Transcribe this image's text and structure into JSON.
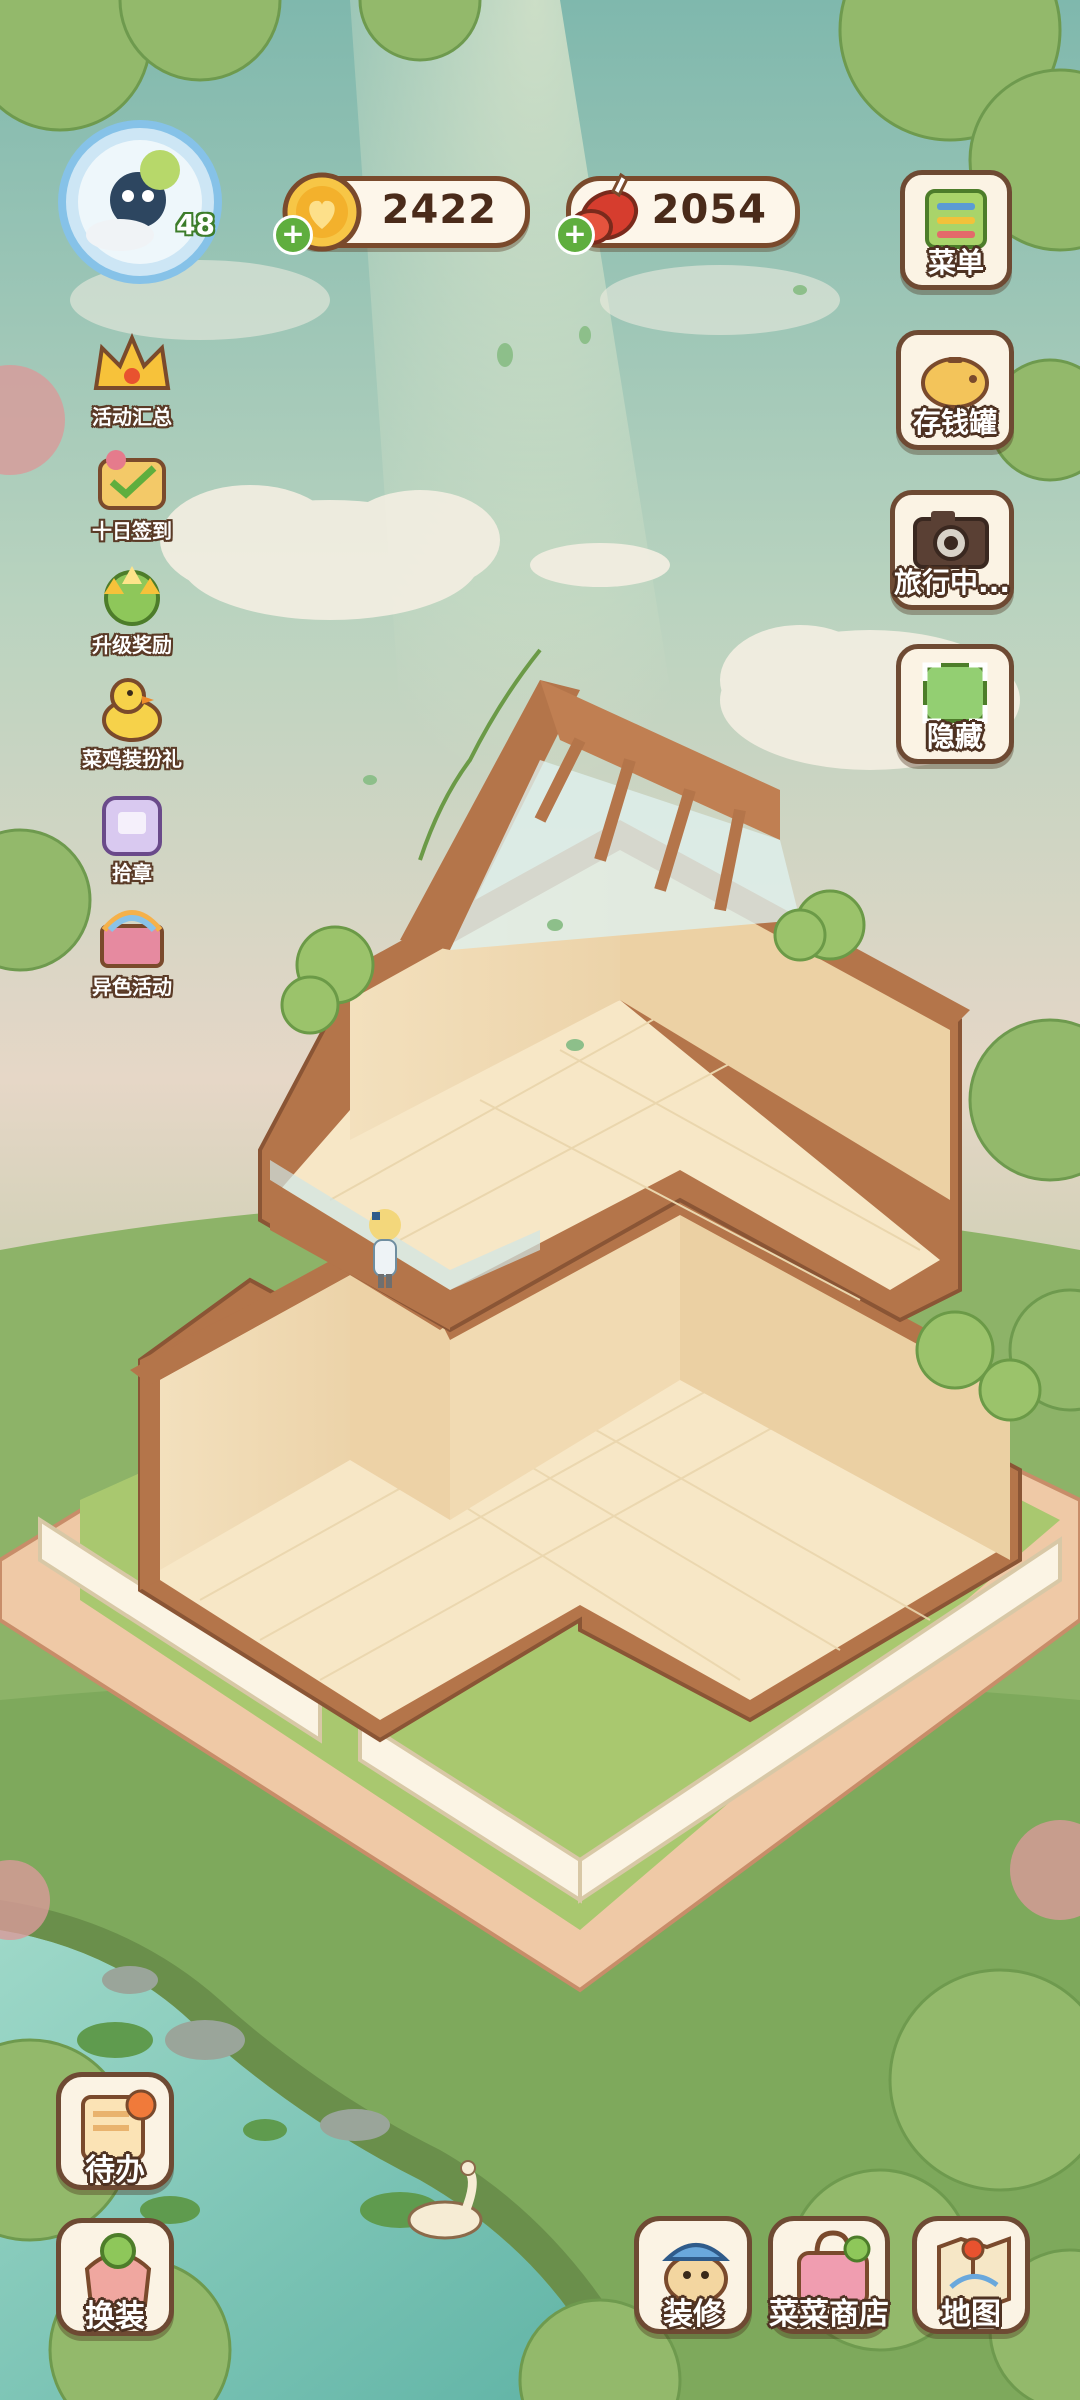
{
  "currency": {
    "coins": "2422",
    "vegetables": "2054"
  },
  "player": {
    "level": "48"
  },
  "left_menu": [
    {
      "label": "活动汇总",
      "icon": "crown-icon"
    },
    {
      "label": "十日签到",
      "icon": "checkin-basket-icon"
    },
    {
      "label": "升级奖励",
      "icon": "upgrade-gift-icon"
    },
    {
      "label": "菜鸡装扮礼",
      "icon": "duck-icon"
    },
    {
      "label": "拾章",
      "icon": "stamp-bag-icon"
    },
    {
      "label": "异色活动",
      "icon": "rainbow-book-icon"
    }
  ],
  "right_menu": [
    {
      "label": "菜单",
      "icon": "menu-list-icon"
    },
    {
      "label": "存钱罐",
      "icon": "piggy-bank-icon"
    },
    {
      "label": "旅行中...",
      "icon": "camera-icon"
    },
    {
      "label": "隐藏",
      "icon": "hide-frame-icon"
    }
  ],
  "bottom_bar": {
    "todo": "待办",
    "outfit": "换装",
    "decorate": "装修",
    "shop": "菜菜商店",
    "map": "地图"
  },
  "colors": {
    "sky": "#c8d9c2",
    "grass": "#8fb46a",
    "wood": "#b4754a",
    "wall": "#f2dcb4",
    "floor": "#f7e7c6",
    "water": "#7cc5b5"
  }
}
